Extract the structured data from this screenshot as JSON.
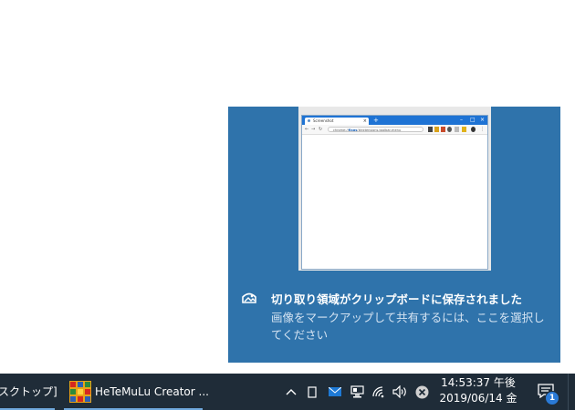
{
  "toast": {
    "title": "切り取り領域がクリップボードに保存されました",
    "body": "画像をマークアップして共有するには、ここを選択してください",
    "icon": "photo-icon",
    "background": "#2f73ab"
  },
  "thumbnail": {
    "tab_title": "Screenshot",
    "url_prefix": "chrome://",
    "url_bold": "flags",
    "url_suffix": "/#extensions-toolbar-menu"
  },
  "taskbar": {
    "desktop_label": "スクトップ]",
    "app_label": "HeTeMuLu Creator ...",
    "clock_time": "14:53:37 午後",
    "clock_date": "2019/06/14 金",
    "notification_count": "1",
    "background": "#1f2c38"
  }
}
